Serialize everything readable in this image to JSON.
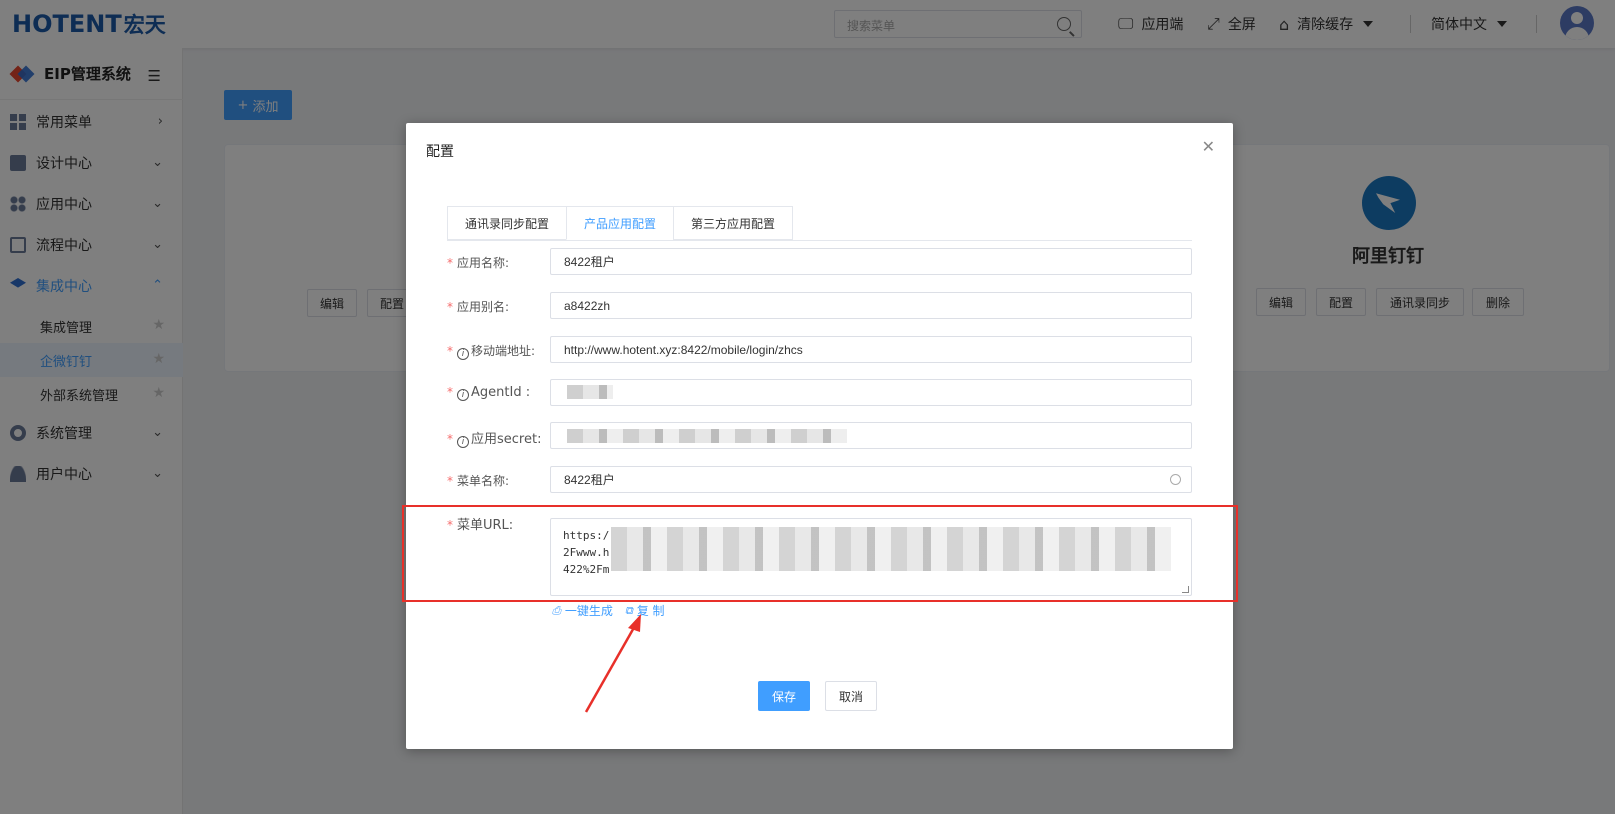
{
  "header": {
    "logo_text": "HOTENT",
    "logo_cn": "宏天",
    "search_placeholder": "搜索菜单",
    "app_end": "应用端",
    "fullscreen": "全屏",
    "clear_cache": "清除缓存",
    "language": "简体中文"
  },
  "sidebar": {
    "system_title": "EIP管理系统",
    "menus": [
      {
        "label": "常用菜单"
      },
      {
        "label": "设计中心"
      },
      {
        "label": "应用中心"
      },
      {
        "label": "流程中心"
      },
      {
        "label": "集成中心"
      },
      {
        "label": "系统管理"
      },
      {
        "label": "用户中心"
      }
    ],
    "sub_items": [
      {
        "label": "集成管理"
      },
      {
        "label": "企微钉钉"
      },
      {
        "label": "外部系统管理"
      }
    ]
  },
  "main": {
    "add_button": "添加",
    "left_card_buttons": [
      "编辑",
      "配置"
    ],
    "right_card": {
      "name": "阿里钉钉",
      "buttons": [
        "编辑",
        "配置",
        "通讯录同步",
        "删除"
      ]
    }
  },
  "dialog": {
    "title": "配置",
    "tabs": [
      "通讯录同步配置",
      "产品应用配置",
      "第三方应用配置"
    ],
    "active_tab": "产品应用配置",
    "fields": {
      "app_name_label": "应用名称:",
      "app_name_value": "8422租户",
      "app_alias_label": "应用别名:",
      "app_alias_value": "a8422zh",
      "mobile_url_label": "移动端地址:",
      "mobile_url_value": "http://www.hotent.xyz:8422/mobile/login/zhcs",
      "agent_id_label": "AgentId :",
      "app_secret_label": "应用secret:",
      "menu_name_label": "菜单名称:",
      "menu_name_value": "8422租户",
      "menu_url_label": "菜单URL:",
      "menu_url_line1": "https:/",
      "menu_url_line2": "2Fwww.h",
      "menu_url_line3": "422%2Fm"
    },
    "generate_link": "一键生成",
    "copy_link": "复 制",
    "save_button": "保存",
    "cancel_button": "取消"
  },
  "colors": {
    "primary": "#409eff",
    "highlight_box": "#e8302a",
    "brand": "#1d5ba9"
  }
}
